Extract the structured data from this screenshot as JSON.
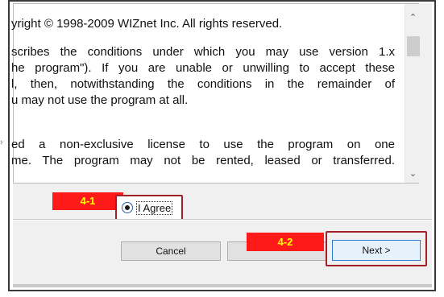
{
  "license": {
    "lines": [
      "yright © 1998-2009 WIZnet Inc. All rights reserved.",
      "scribes the conditions under which you may use version 1.x",
      "he program\"). If you are unable or unwilling to accept these",
      "l, then, notwithstanding the conditions in the remainder of",
      "u may not use the program at all.",
      "",
      "ed a non-exclusive license to use the program on one",
      "me. The program may not be rented, leased or transferred."
    ]
  },
  "annotations": {
    "step1": "4-1",
    "step2": "4-2"
  },
  "agree": {
    "label": "I Agree",
    "selected": true
  },
  "buttons": {
    "cancel": "Cancel",
    "back": "",
    "next": "Next >"
  },
  "colors": {
    "annotation_bg": "#ff1a1a",
    "annotation_text": "#ffff00",
    "highlight_border": "#a0202a"
  },
  "icons": {
    "scroll_up": "chevron-up-icon",
    "scroll_down": "chevron-down-icon",
    "side_arrow": "chevron-right-icon"
  }
}
